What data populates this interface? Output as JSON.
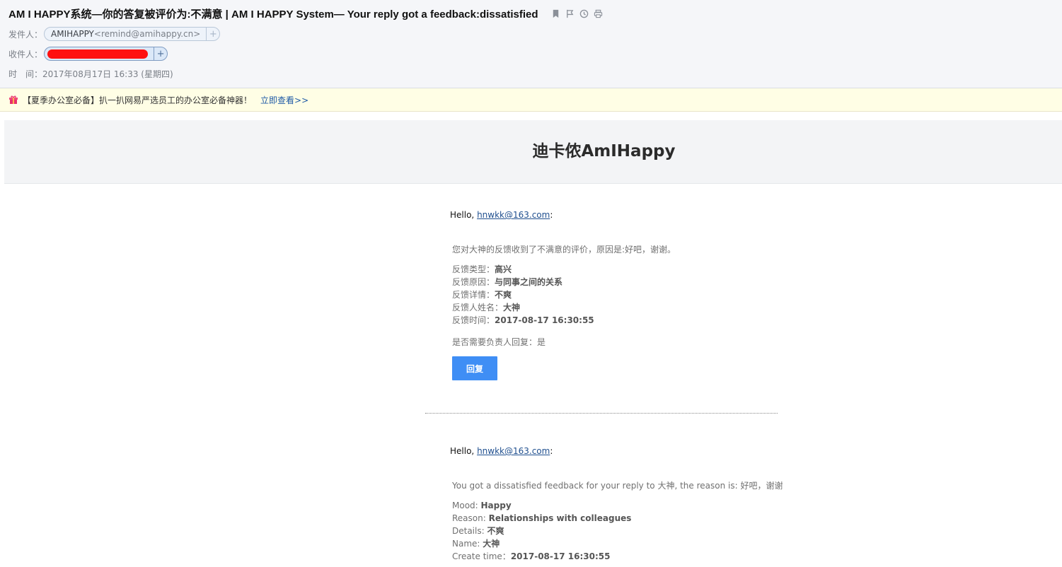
{
  "header": {
    "subject": "AM I HAPPY系统—你的答复被评价为:不满意 | AM I HAPPY System— Your reply got a feedback:dissatisfied",
    "tools": [
      "bookmark-icon",
      "flag-icon",
      "clock-icon",
      "print-icon"
    ],
    "from_label": "发件人：",
    "from_name": "AMIHAPPY",
    "from_email": "<remind@amihappy.cn>",
    "to_label": "收件人：",
    "time_label": "时　间：",
    "time_value": "2017年08月17日 16:33 (星期四)",
    "plus": "+"
  },
  "ad": {
    "text": "【夏季办公室必备】扒一扒网易严选员工的办公室必备神器！",
    "link": "立即查看>>"
  },
  "brand": {
    "title": "迪卡侬AmIHappy"
  },
  "cn": {
    "hello": "Hello,",
    "email": "hnwkk@163.com",
    "colon": ":",
    "intro": "您对大神的反馈收到了不满意的评价，原因是:好吧，谢谢。",
    "fields": [
      {
        "label": "反馈类型：",
        "value": "高兴"
      },
      {
        "label": "反馈原因：",
        "value": "与同事之间的关系"
      },
      {
        "label": "反馈详情：",
        "value": "不爽"
      },
      {
        "label": "反馈人姓名：",
        "value": "大神"
      },
      {
        "label": "反馈时间：",
        "value": "2017-08-17 16:30:55"
      }
    ],
    "need_reply": "是否需要负责人回复：是",
    "reply_button": "回复"
  },
  "en": {
    "hello": "Hello,",
    "email": "hnwkk@163.com",
    "colon": ":",
    "intro": "You got a dissatisfied feedback for your reply to 大神, the reason is: 好吧，谢谢",
    "fields": [
      {
        "label": "Mood: ",
        "value": "Happy"
      },
      {
        "label": "Reason: ",
        "value": "Relationships with colleagues"
      },
      {
        "label": "Details: ",
        "value": "不爽"
      },
      {
        "label": "Name: ",
        "value": "大神"
      },
      {
        "label": "Create time：",
        "value": "2017-08-17 16:30:55"
      }
    ]
  },
  "colors": {
    "accent": "#3f8ef5",
    "redaction": "#ff1010",
    "link": "#1f4f8f"
  }
}
